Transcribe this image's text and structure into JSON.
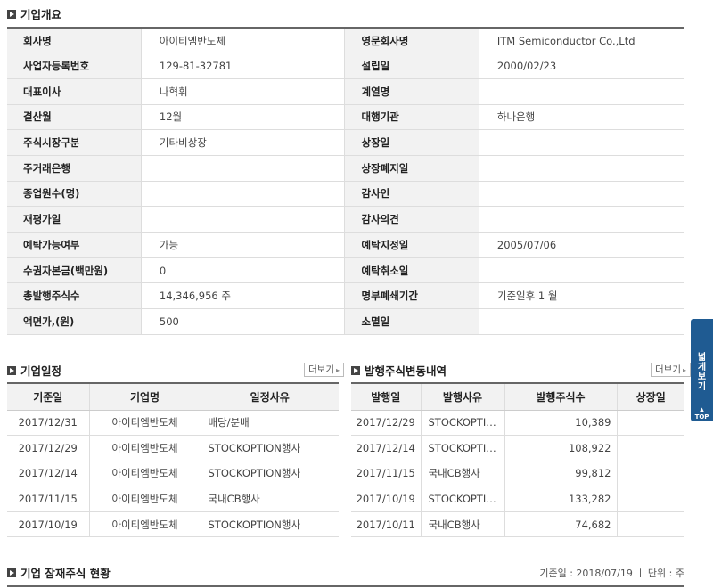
{
  "overview": {
    "title": "기업개요",
    "rows": [
      [
        "회사명",
        "아이티엠반도체",
        "영문회사명",
        "ITM Semiconductor Co.,Ltd"
      ],
      [
        "사업자등록번호",
        "129-81-32781",
        "설립일",
        "2000/02/23"
      ],
      [
        "대표이사",
        "나혁휘",
        "계열명",
        ""
      ],
      [
        "결산월",
        "12월",
        "대행기관",
        "하나은행"
      ],
      [
        "주식시장구분",
        "기타비상장",
        "상장일",
        ""
      ],
      [
        "주거래은행",
        "",
        "상장폐지일",
        ""
      ],
      [
        "종업원수(명)",
        "",
        "감사인",
        ""
      ],
      [
        "재평가일",
        "",
        "감사의견",
        ""
      ],
      [
        "예탁가능여부",
        "가능",
        "예탁지정일",
        "2005/07/06"
      ],
      [
        "수권자본금(백만원)",
        "0",
        "예탁취소일",
        ""
      ],
      [
        "총발행주식수",
        "14,346,956 주",
        "명부폐쇄기간",
        "기준일후 1 월"
      ],
      [
        "액면가,(원)",
        "500",
        "소멸일",
        ""
      ]
    ]
  },
  "schedule": {
    "title": "기업일정",
    "more_label": "더보기",
    "headers": [
      "기준일",
      "기업명",
      "일정사유"
    ],
    "rows": [
      [
        "2017/12/31",
        "아이티엠반도체",
        "배당/분배"
      ],
      [
        "2017/12/29",
        "아이티엠반도체",
        "STOCKOPTION행사"
      ],
      [
        "2017/12/14",
        "아이티엠반도체",
        "STOCKOPTION행사"
      ],
      [
        "2017/11/15",
        "아이티엠반도체",
        "국내CB행사"
      ],
      [
        "2017/10/19",
        "아이티엠반도체",
        "STOCKOPTION행사"
      ]
    ]
  },
  "issuance": {
    "title": "발행주식변동내역",
    "more_label": "더보기",
    "headers": [
      "발행일",
      "발행사유",
      "발행주식수",
      "상장일"
    ],
    "rows": [
      [
        "2017/12/29",
        "STOCKOPTI…",
        "10,389",
        ""
      ],
      [
        "2017/12/14",
        "STOCKOPTI…",
        "108,922",
        ""
      ],
      [
        "2017/11/15",
        "국내CB행사",
        "99,812",
        ""
      ],
      [
        "2017/10/19",
        "STOCKOPTI…",
        "133,282",
        ""
      ],
      [
        "2017/10/11",
        "국내CB행사",
        "74,682",
        ""
      ]
    ]
  },
  "latent": {
    "title": "기업 잠재주식 현황",
    "ref_note": "기준일 : 2018/07/19 ㅣ 단위 : 주"
  },
  "side_tab": {
    "wide_label": "넓게보기",
    "top_label": "TOP"
  },
  "colors": {
    "side_tab": "#1f5b92",
    "header_bg": "#f2f2f2"
  }
}
